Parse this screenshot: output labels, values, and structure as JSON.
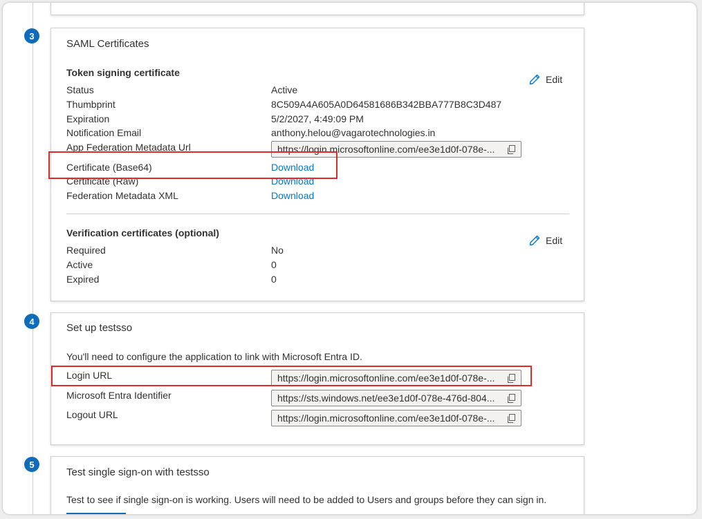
{
  "steps": {
    "s3": "3",
    "s4": "4",
    "s5": "5"
  },
  "saml": {
    "title": "SAML Certificates",
    "token_heading": "Token signing certificate",
    "edit_label": "Edit",
    "status_label": "Status",
    "status_value": "Active",
    "thumbprint_label": "Thumbprint",
    "thumbprint_value": "8C509A4A605A0D64581686B342BBA777B8C3D487",
    "expiration_label": "Expiration",
    "expiration_value": "5/2/2027, 4:49:09 PM",
    "email_label": "Notification Email",
    "email_value": "anthony.helou@vagarotechnologies.in",
    "metadata_url_label": "App Federation Metadata Url",
    "metadata_url_value": "https://login.microsoftonline.com/ee3e1d0f-078e-...",
    "cert_base64_label": "Certificate (Base64)",
    "cert_base64_link": "Download",
    "cert_raw_label": "Certificate (Raw)",
    "cert_raw_link": "Download",
    "fed_xml_label": "Federation Metadata XML",
    "fed_xml_link": "Download",
    "verif_heading": "Verification certificates (optional)",
    "verif_edit_label": "Edit",
    "required_label": "Required",
    "required_value": "No",
    "active_label": "Active",
    "active_value": "0",
    "expired_label": "Expired",
    "expired_value": "0"
  },
  "setup": {
    "title": "Set up testsso",
    "description": "You'll need to configure the application to link with Microsoft Entra ID.",
    "login_url_label": "Login URL",
    "login_url_value": "https://login.microsoftonline.com/ee3e1d0f-078e-...",
    "entra_id_label": "Microsoft Entra Identifier",
    "entra_id_value": "https://sts.windows.net/ee3e1d0f-078e-476d-804...",
    "logout_url_label": "Logout URL",
    "logout_url_value": "https://login.microsoftonline.com/ee3e1d0f-078e-..."
  },
  "test": {
    "title": "Test single sign-on with testsso",
    "description": "Test to see if single sign-on is working. Users will need to be added to Users and groups before they can sign in."
  },
  "colors": {
    "accent": "#0f6cbd",
    "link": "#0078d4",
    "highlight": "#e02a2a"
  }
}
